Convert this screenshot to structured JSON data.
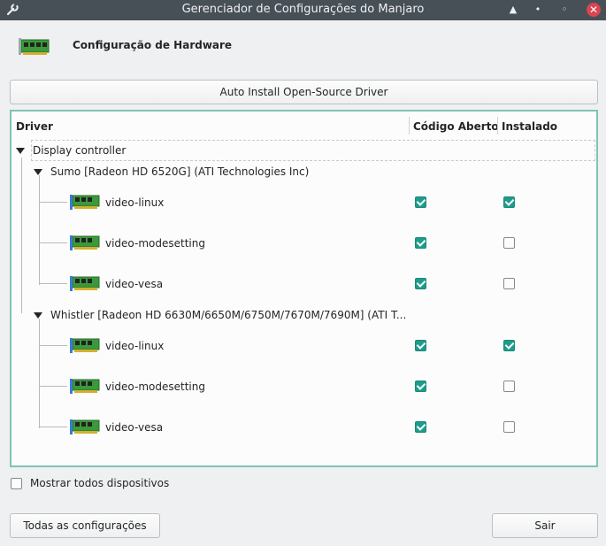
{
  "window": {
    "title": "Gerenciador de Configurações do Manjaro",
    "icons": {
      "app": "wrench-icon",
      "shade": "shade-up-icon",
      "minimize": "minimize-icon",
      "restore": "restore-icon",
      "close": "close-icon"
    }
  },
  "header": {
    "title": "Configuração de Hardware",
    "icon": "hardware-card-icon"
  },
  "auto_install_label": "Auto Install Open-Source Driver",
  "table": {
    "columns": [
      "Driver",
      "Código Aberto",
      "Instalado"
    ],
    "category": "Display controller",
    "devices": [
      {
        "name": "Sumo [Radeon HD 6520G] (ATI Technologies Inc)",
        "drivers": [
          {
            "name": "video-linux",
            "open_source": true,
            "installed": true
          },
          {
            "name": "video-modesetting",
            "open_source": true,
            "installed": false
          },
          {
            "name": "video-vesa",
            "open_source": true,
            "installed": false
          }
        ]
      },
      {
        "name": "Whistler [Radeon HD 6630M/6650M/6750M/7670M/7690M] (ATI T...",
        "drivers": [
          {
            "name": "video-linux",
            "open_source": true,
            "installed": true
          },
          {
            "name": "video-modesetting",
            "open_source": true,
            "installed": false
          },
          {
            "name": "video-vesa",
            "open_source": true,
            "installed": false
          }
        ]
      }
    ]
  },
  "show_all_label": "Mostrar todos dispositivos",
  "show_all_checked": false,
  "footer": {
    "all_settings_label": "Todas as configurações",
    "exit_label": "Sair"
  },
  "colors": {
    "accent": "#1e9c8b",
    "titlebar": "#475057",
    "close": "#da4453"
  }
}
